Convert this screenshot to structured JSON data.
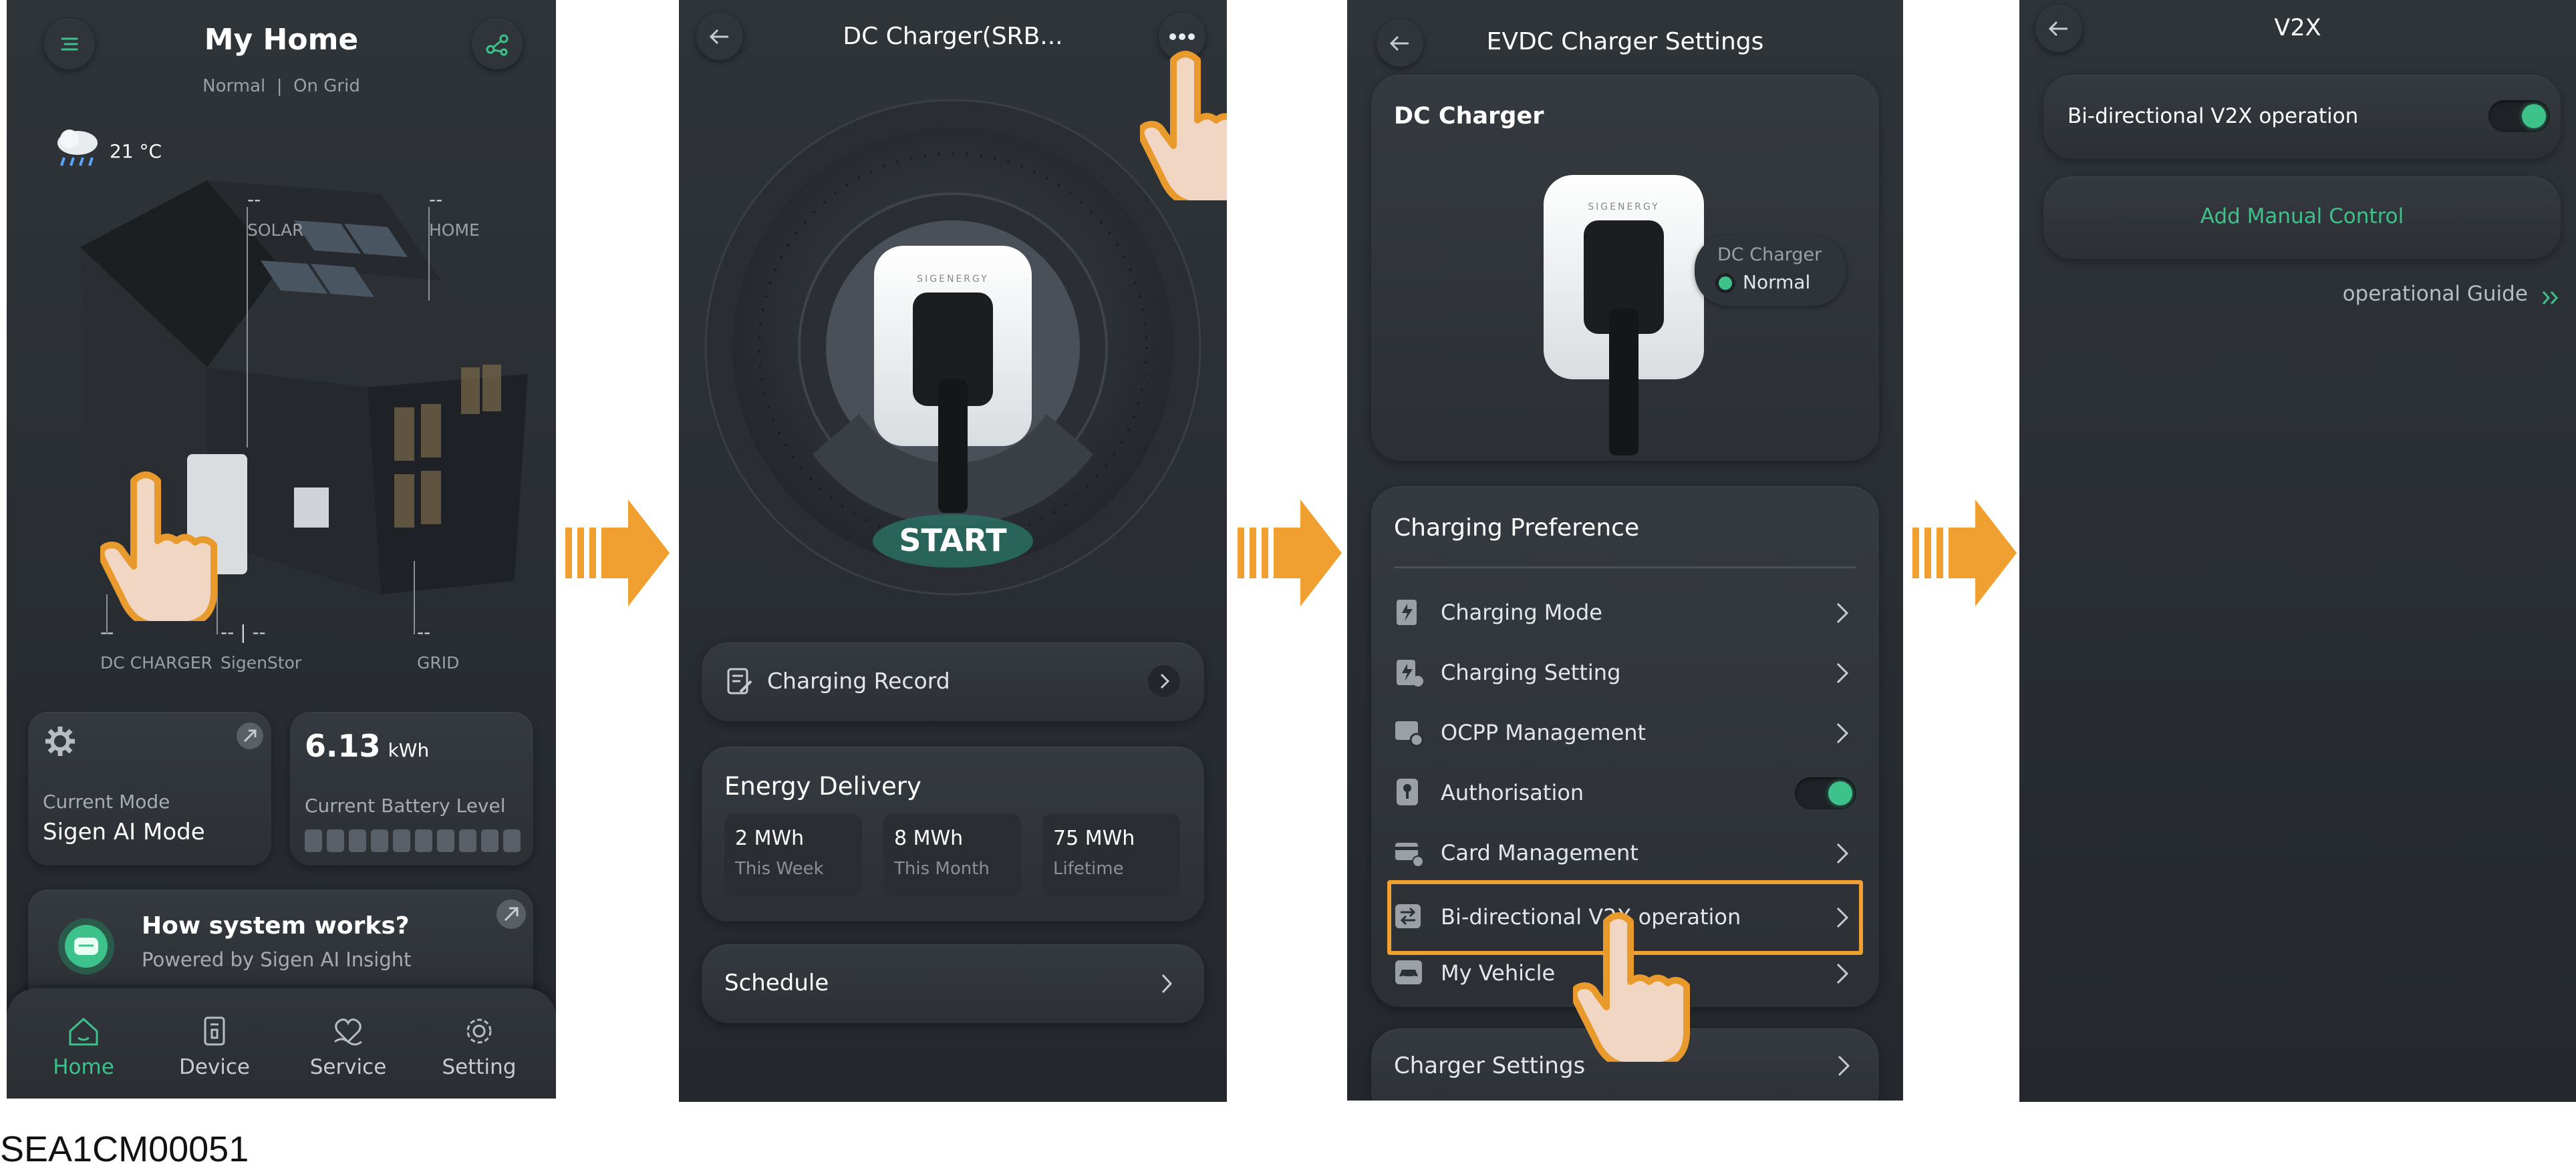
{
  "screen1": {
    "title": "My Home",
    "status": "Normal  |  On Grid",
    "temperature": "21 °C",
    "labels": {
      "solar_value": "--",
      "solar": "SOLAR",
      "home_value": "--",
      "home": "HOME",
      "dc_value": "--",
      "dc": "DC CHARGER",
      "sigenstor_value": "-- | --",
      "sigenstor": "SigenStor",
      "grid_value": "--",
      "grid": "GRID"
    },
    "mode_card": {
      "caption": "Current Mode",
      "value": "Sigen AI Mode"
    },
    "battery_card": {
      "value": "6.13",
      "unit": "kWh",
      "caption": "Current Battery Level"
    },
    "how_card": {
      "title": "How system works?",
      "subtitle": "Powered by Sigen AI Insight"
    },
    "nav": [
      {
        "label": "Home",
        "icon": "home-icon",
        "active": true
      },
      {
        "label": "Device",
        "icon": "device-icon",
        "active": false
      },
      {
        "label": "Service",
        "icon": "service-icon",
        "active": false
      },
      {
        "label": "Setting",
        "icon": "setting-icon",
        "active": false
      }
    ]
  },
  "screen2": {
    "title": "DC Charger(SRB...",
    "start_label": "START",
    "device_logo": "SIGENERGY",
    "charging_record": "Charging Record",
    "energy": {
      "title": "Energy Delivery",
      "items": [
        {
          "value": "2 MWh",
          "caption": "This Week"
        },
        {
          "value": "8 MWh",
          "caption": "This Month"
        },
        {
          "value": "75 MWh",
          "caption": "Lifetime"
        }
      ]
    },
    "schedule": "Schedule"
  },
  "screen3": {
    "title": "EVDC Charger Settings",
    "card_title": "DC Charger",
    "device_logo": "SIGENERGY",
    "status_title": "DC Charger",
    "status_value": "Normal",
    "pref_title": "Charging Preference",
    "rows": [
      {
        "label": "Charging Mode",
        "type": "chevron"
      },
      {
        "label": "Charging Setting",
        "type": "chevron"
      },
      {
        "label": "OCPP Management",
        "type": "chevron"
      },
      {
        "label": "Authorisation",
        "type": "toggle"
      },
      {
        "label": "Card Management",
        "type": "chevron"
      },
      {
        "label": "Bi-directional V2X operation",
        "type": "chevron"
      },
      {
        "label": "My Vehicle",
        "type": "chevron"
      }
    ],
    "charger_settings": "Charger Settings"
  },
  "screen4": {
    "title": "V2X",
    "toggle_label": "Bi-directional V2X operation",
    "add_control": "Add Manual Control",
    "guide": "operational Guide"
  },
  "caption": "SEA1CM00051",
  "colors": {
    "accent": "#3ec28b",
    "highlight": "#f0a030",
    "bg": "#2a2e33"
  }
}
